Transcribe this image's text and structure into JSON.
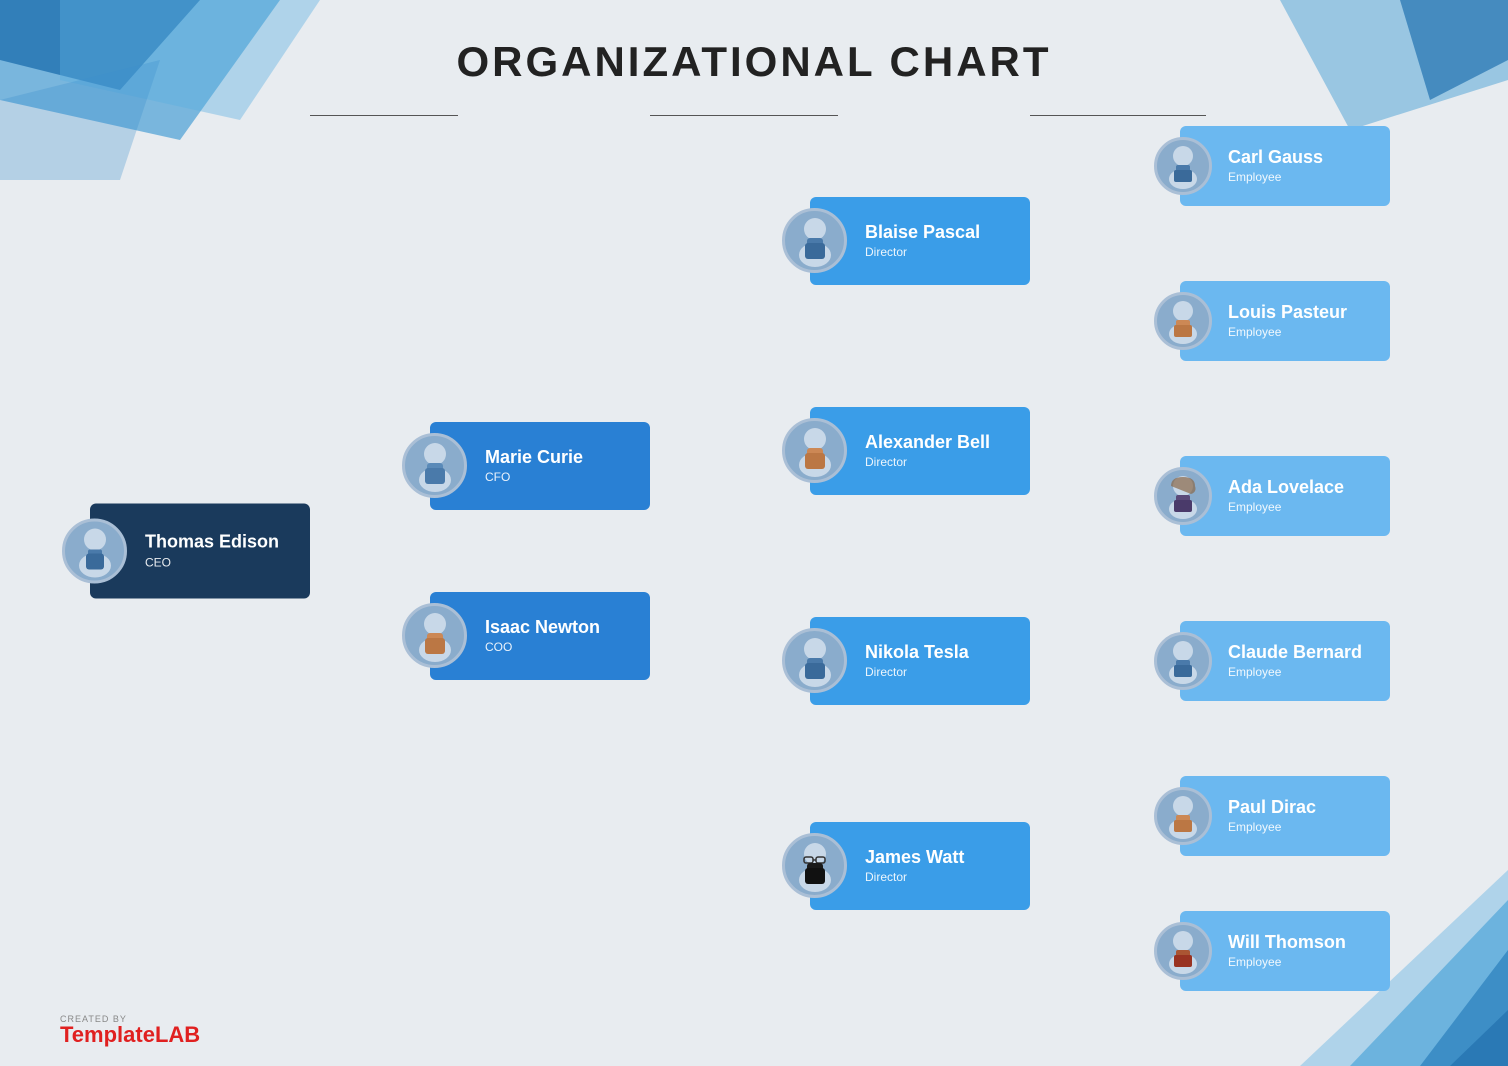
{
  "title": "ORGANIZATIONAL CHART",
  "ceo": {
    "name": "Thomas Edison",
    "role": "CEO"
  },
  "vp_level": [
    {
      "name": "Marie Curie",
      "role": "CFO"
    },
    {
      "name": "Isaac Newton",
      "role": "COO"
    }
  ],
  "director_level": [
    {
      "name": "Blaise Pascal",
      "role": "Director"
    },
    {
      "name": "Alexander Bell",
      "role": "Director"
    },
    {
      "name": "Nikola Tesla",
      "role": "Director"
    },
    {
      "name": "James Watt",
      "role": "Director"
    }
  ],
  "employee_level": [
    {
      "name": "Carl Gauss",
      "role": "Employee"
    },
    {
      "name": "Louis Pasteur",
      "role": "Employee"
    },
    {
      "name": "Ada Lovelace",
      "role": "Employee"
    },
    {
      "name": "Claude Bernard",
      "role": "Employee"
    },
    {
      "name": "Paul Dirac",
      "role": "Employee"
    },
    {
      "name": "Will Thomson",
      "role": "Employee"
    }
  ],
  "watermark": {
    "created_by": "CREATED BY",
    "brand_light": "Template",
    "brand_bold": "LAB"
  },
  "colors": {
    "ceo_bg": "#1a3a5c",
    "vp_bg": "#2980d4",
    "director_bg": "#3a9de8",
    "employee_bg": "#6bb8f0",
    "avatar_bg": "#8aaccc",
    "line_color": "#555",
    "bg": "#e8ecf0"
  }
}
